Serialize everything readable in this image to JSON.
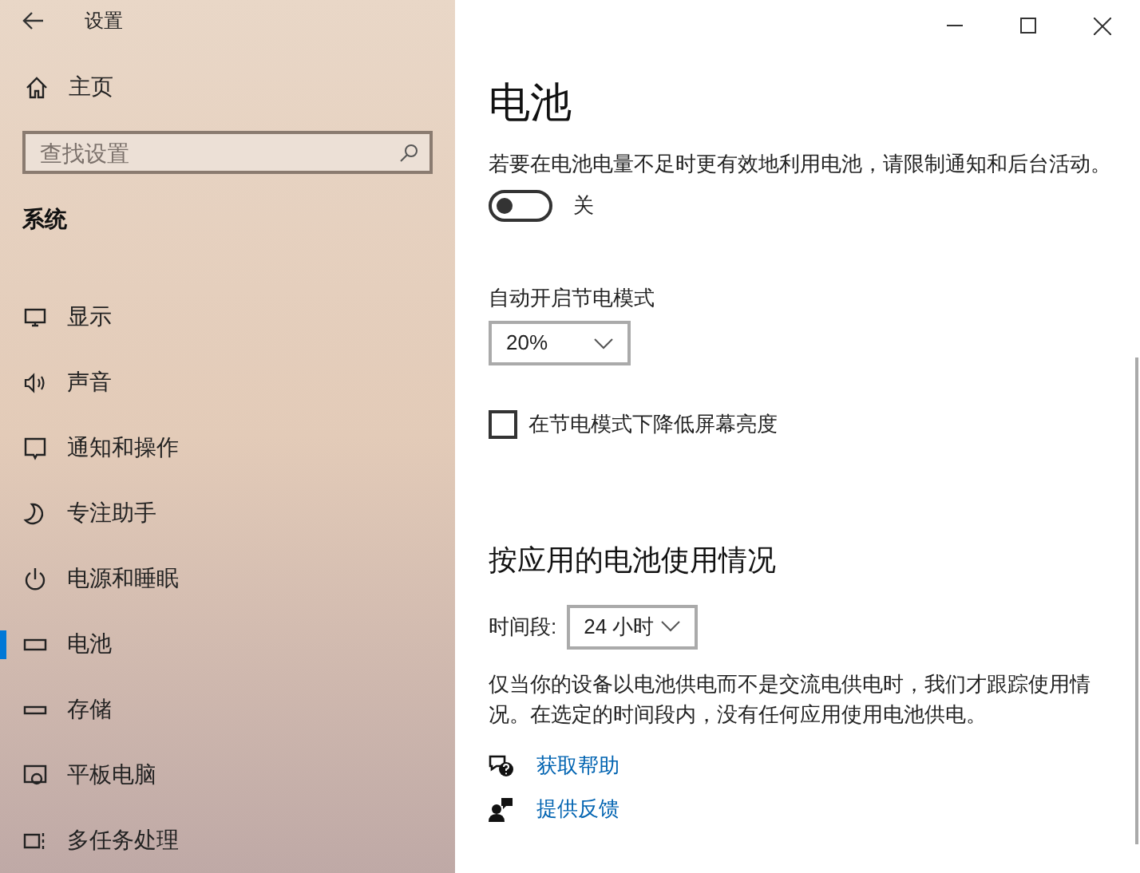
{
  "window": {
    "title": "设置"
  },
  "sidebar": {
    "home": "主页",
    "search": {
      "placeholder": "查找设置"
    },
    "section": "系统",
    "items": [
      {
        "label": "显示",
        "kind": "display",
        "selected": false
      },
      {
        "label": "声音",
        "kind": "sound",
        "selected": false
      },
      {
        "label": "通知和操作",
        "kind": "notification",
        "selected": false
      },
      {
        "label": "专注助手",
        "kind": "moon",
        "selected": false
      },
      {
        "label": "电源和睡眠",
        "kind": "power",
        "selected": false
      },
      {
        "label": "电池",
        "kind": "battery",
        "selected": true
      },
      {
        "label": "存储",
        "kind": "storage",
        "selected": false
      },
      {
        "label": "平板电脑",
        "kind": "tablet",
        "selected": false
      },
      {
        "label": "多任务处理",
        "kind": "multitask",
        "selected": false
      }
    ]
  },
  "page": {
    "title": "电池",
    "saver_description": "若要在电池电量不足时更有效地利用电池，请限制通知和后台活动。",
    "saver_toggle": {
      "on": false,
      "label": "关"
    },
    "auto_label": "自动开启节电模式",
    "auto_dropdown": "20%",
    "brightness_checkbox": {
      "label": "在节电模式下降低屏幕亮度",
      "checked": false
    },
    "usage_title": "按应用的电池使用情况",
    "period_label": "时间段:",
    "period_dropdown": "24 小时",
    "usage_note": "仅当你的设备以电池供电而不是交流电供电时，我们才跟踪使用情况。在选定的时间段内，没有任何应用使用电池供电。",
    "links": [
      {
        "label": "获取帮助",
        "kind": "help"
      },
      {
        "label": "提供反馈",
        "kind": "feedback"
      }
    ]
  }
}
